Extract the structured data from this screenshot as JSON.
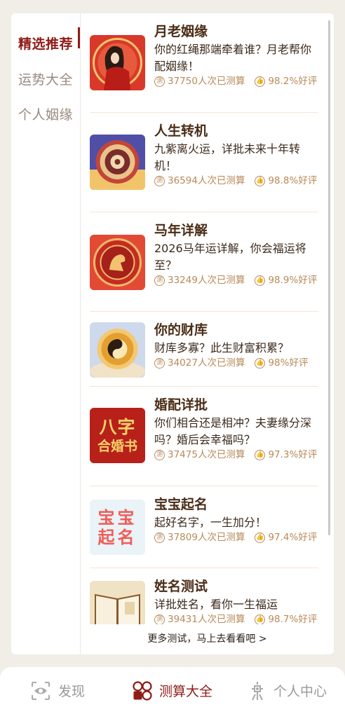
{
  "sidebar": {
    "items": [
      {
        "label": "精选推荐"
      },
      {
        "label": "运势大全"
      },
      {
        "label": "个人姻缘"
      }
    ]
  },
  "list": [
    {
      "title": "月老姻缘",
      "desc": "你的红绳那端牵着谁？月老帮你配姻缘！",
      "count": "37750人次已测算",
      "rating": "98.2%好评",
      "icon": "matchmaker-image"
    },
    {
      "title": "人生转机",
      "desc": "九紫离火运，详批未来十年转机！",
      "count": "36594人次已测算",
      "rating": "98.8%好评",
      "icon": "zodiac-wheel-image"
    },
    {
      "title": "马年详解",
      "desc": "2026马年运详解，你会福运将至？",
      "count": "33249人次已测算",
      "rating": "98.9%好评",
      "icon": "horse-year-image"
    },
    {
      "title": "你的财库",
      "desc": "财库多寡？此生财富积累？",
      "count": "34027人次已测算",
      "rating": "98%好评",
      "icon": "wealth-image"
    },
    {
      "title": "婚配详批",
      "desc": "你们相合还是相冲？夫妻缘分深吗？婚后会幸福吗？",
      "count": "37475人次已测算",
      "rating": "97.3%好评",
      "icon": "marriage-book-image",
      "thumb_text": [
        "八字",
        "合婚书"
      ]
    },
    {
      "title": "宝宝起名",
      "desc": "起好名字，一生加分！",
      "count": "37809人次已测算",
      "rating": "97.4%好评",
      "icon": "baby-naming-image",
      "thumb_text": [
        "宝宝",
        "起名"
      ]
    },
    {
      "title": "姓名测试",
      "desc": "详批姓名，看你一生福运",
      "count": "39431人次已测算",
      "rating": "98.7%好评",
      "icon": "name-test-image"
    }
  ],
  "more_link": "更多测试，马上去看看吧 >",
  "meta_icons": {
    "count_glyph": "测",
    "rating_icon": "thumbs-up-icon"
  },
  "tabbar": {
    "tabs": [
      {
        "label": "发现",
        "icon": "eye-icon"
      },
      {
        "label": "测算大全",
        "icon": "grid-icon"
      },
      {
        "label": "个人中心",
        "icon": "knot-icon"
      }
    ]
  },
  "colors": {
    "accent": "#8e1c17",
    "meta": "#b88a5a",
    "background": "#f1eee7"
  }
}
